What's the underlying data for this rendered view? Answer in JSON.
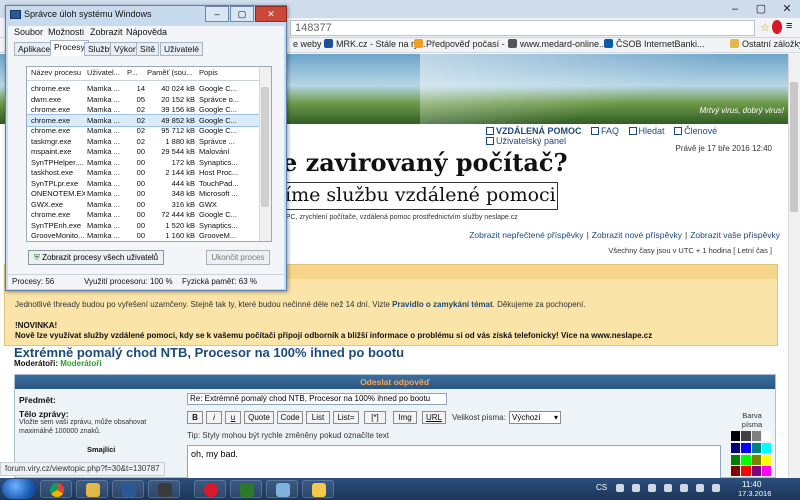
{
  "browser": {
    "url_fragment": "148377",
    "bookmarks": [
      {
        "label": "e weby"
      },
      {
        "label": "MRK.cz - Stále na ry..."
      },
      {
        "label": "Předpověď počasí - ..."
      },
      {
        "label": "www.medard-online..."
      },
      {
        "label": "ČSOB InternetBanki..."
      },
      {
        "label": "Ostatní záložky"
      }
    ],
    "status_url": "forum.viry.cz/viewtopic.php?f=30&t=130787"
  },
  "page": {
    "slogan": "Mrtvý virus, dobrý virus!",
    "nav": {
      "remote_help": "VZDÁLENÁ POMOC",
      "faq": "FAQ",
      "search": "Hledat",
      "members": "Členové",
      "user_panel": "Uživatelský panel"
    },
    "datetime": "Právě je 17 bře 2016 12:40",
    "headline": "e zavirovaný počítač?",
    "tagline": "íme službu vzdálené pomoci!",
    "subline": "í PC, zrychlení počítače, vzdálená pomoc prostřednictvím služby neslape.cz",
    "userlinks": {
      "unread": "Zobrazit nepřečtené příspěvky",
      "new": "Zobrazit nové příspěvky",
      "own": "Zobrazit vaše příspěvky"
    },
    "timezone": "Všechny časy jsou v UTC + 1 hodina [ Letní čas ]",
    "notice": {
      "line1_before": "Jednotlivé thready budou po vyřešení uzamčeny. Stejně tak ty, které budou nečinné déle než 14 dní. Vizte ",
      "line1_link": "Pravidlo o zamykání témat",
      "line1_after": ". Děkujeme za pochopení.",
      "line2": "!NOVINKA!",
      "line3": "Nově lze využívat služby vzdálené pomoci, kdy se k vašemu počítači připojí odborník a bližší informace o problému si od vás získá telefonicky! Více na www.neslape.cz"
    },
    "topic_title": "Extrémně pomalý chod NTB, Procesor na 100% ihned po bootu",
    "moderators_label": "Moderátoři:",
    "moderators_value": "Moderátoři",
    "post": {
      "header": "Odeslat odpověď",
      "subject_label": "Předmět:",
      "subject_value": "Re: Extrémně pomalý chod NTB, Procesor na 100% ihned po bootu",
      "message_label": "Tělo zprávy:",
      "message_help": "Vložte sem vaši zprávu, může obsahovat maximálně 100000 znaků.",
      "smileys": "Smajlíci",
      "buttons": [
        "B",
        "i",
        "u",
        "Quote",
        "Code",
        "List",
        "List=",
        "[*]",
        "Img",
        "URL"
      ],
      "font_size_label": "Velikost písma:",
      "font_size_value": "Výchozí",
      "tip": "Tip: Styly mohou být rychle změněny pokud označíte text",
      "text": "oh, my bad.",
      "color_label": "Barva písma",
      "palette": [
        "#000000",
        "#404040",
        "#808080",
        "#ffffff",
        "#00007f",
        "#0000ff",
        "#007f7f",
        "#00ffff",
        "#007f00",
        "#00ff00",
        "#7f7f00",
        "#ffff00",
        "#7f0000",
        "#ff0000",
        "#7f007f",
        "#ff00ff"
      ]
    }
  },
  "taskmanager": {
    "title": "Správce úloh systému Windows",
    "menu": [
      "Soubor",
      "Možnosti",
      "Zobrazit",
      "Nápověda"
    ],
    "tabs": [
      "Aplikace",
      "Procesy",
      "Služby",
      "Výkon",
      "Sítě",
      "Uživatelé"
    ],
    "active_tab": "Procesy",
    "columns": [
      "Název procesu",
      "Uživatel...",
      "P...",
      "Paměť (sou...",
      "Popis"
    ],
    "rows": [
      [
        "chrome.exe",
        "Mamka ...",
        "14",
        "40 024 kB",
        "Google C..."
      ],
      [
        "dwm.exe",
        "Mamka ...",
        "05",
        "20 152 kB",
        "Správce o..."
      ],
      [
        "chrome.exe",
        "Mamka ...",
        "02",
        "39 156 kB",
        "Google C..."
      ],
      [
        "chrome.exe",
        "Mamka ...",
        "02",
        "49 852 kB",
        "Google C..."
      ],
      [
        "chrome.exe",
        "Mamka ...",
        "02",
        "95 712 kB",
        "Google C..."
      ],
      [
        "taskmgr.exe",
        "Mamka ...",
        "02",
        "1 880 kB",
        "Správce ..."
      ],
      [
        "mspaint.exe",
        "Mamka ...",
        "00",
        "29 544 kB",
        "Malování"
      ],
      [
        "SynTPHelper....",
        "Mamka ...",
        "00",
        "172 kB",
        "Synaptics..."
      ],
      [
        "taskhost.exe",
        "Mamka ...",
        "00",
        "2 144 kB",
        "Host Proc..."
      ],
      [
        "SynTPLpr.exe",
        "Mamka ...",
        "00",
        "444 kB",
        "TouchPad..."
      ],
      [
        "ONENOTEM.EXE",
        "Mamka ...",
        "00",
        "348 kB",
        "Microsoft ..."
      ],
      [
        "GWX.exe",
        "Mamka ...",
        "00",
        "316 kB",
        "GWX"
      ],
      [
        "chrome.exe",
        "Mamka ...",
        "00",
        "72 444 kB",
        "Google C..."
      ],
      [
        "SynTPEnh.exe",
        "Mamka ...",
        "00",
        "1 520 kB",
        "Synaptics..."
      ],
      [
        "GrooveMonito...",
        "Mamka ...",
        "00",
        "1 160 kB",
        "GrooveM..."
      ]
    ],
    "selected_row": 3,
    "show_all_button": "Zobrazit procesy všech uživatelů",
    "end_process_button": "Ukončit proces",
    "status": {
      "processes": "Procesy: 56",
      "cpu": "Využití procesoru: 100 %",
      "memory": "Fyzická paměť: 63 %"
    }
  },
  "taskbar": {
    "language": "CS",
    "time": "11:40",
    "date": "17.3.2016"
  }
}
